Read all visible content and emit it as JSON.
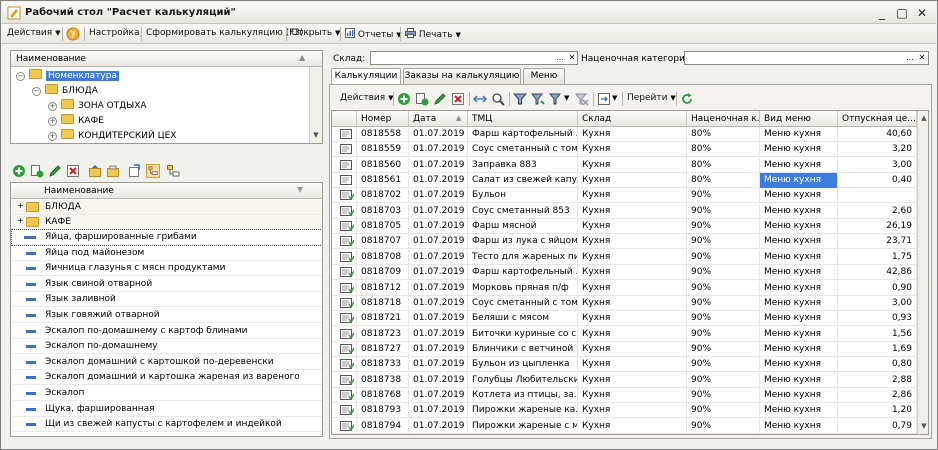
{
  "window": {
    "title": "Рабочий стол \"Расчет калькуляций\"",
    "minimize": "_",
    "maximize": "□",
    "close": "✕"
  },
  "toolbar": {
    "actions": "Действия",
    "settings": "Настройка",
    "form_calc": "Сформировать калькуляцию (F3)",
    "open": "Открыть",
    "reports": "Отчеты",
    "print": "Печать"
  },
  "tree": {
    "header": "Наименование",
    "items": [
      {
        "label": "Номенклатура",
        "level": 0
      },
      {
        "label": "БЛЮДА",
        "level": 1
      },
      {
        "label": "ЗОНА ОТДЫХА",
        "level": 2
      },
      {
        "label": "КАФЕ",
        "level": 2
      },
      {
        "label": "КОНДИТЕРСКИЙ ЦЕХ",
        "level": 2
      }
    ]
  },
  "list": {
    "header": "Наименование",
    "groups": [
      "БЛЮДА",
      "КАФЕ"
    ],
    "items": [
      "Яйца, фаршированные грибами",
      "Яйца под майонезом",
      "Яичница глазунья с мясн продуктами",
      "Язык свиной отварной",
      "Язык заливной",
      "Язык говяжий отварной",
      "Эскалоп по-домашнему с картоф блинами",
      "Эскалоп по-домашнему",
      "Эскалоп домашний с картошкой по-деревенски",
      "Эскалоп домашний и картошка жареная из вареного",
      "Эскалоп",
      "Щука, фаршированная",
      "Щи из свежей капусты с картофелем и индейкой"
    ]
  },
  "filters": {
    "warehouse_label": "Склад:",
    "warehouse_value": "",
    "category_label": "Наценочная категория:",
    "category_value": "",
    "dots": "...",
    "clear": "✕"
  },
  "tabs": [
    "Калькуляции",
    "Заказы на калькуляцию",
    "Меню"
  ],
  "grid_toolbar": {
    "actions": "Действия",
    "goto": "Перейти"
  },
  "grid": {
    "columns": [
      "Номер",
      "Дата",
      "ТМЦ",
      "Склад",
      "Наценочная к...",
      "Вид меню",
      "Отпускная це..."
    ],
    "rows": [
      [
        "0818558",
        "01.07.2019",
        "Фарш картофельный ...",
        "Кухня",
        "80%",
        "Меню кухня",
        "40,60"
      ],
      [
        "0818559",
        "01.07.2019",
        "Соус сметанный с том...",
        "Кухня",
        "80%",
        "Меню кухня",
        "3,20"
      ],
      [
        "0818560",
        "01.07.2019",
        "Заправка 883",
        "Кухня",
        "80%",
        "Меню кухня",
        "3,00"
      ],
      [
        "0818561",
        "01.07.2019",
        "Салат из свежей капу...",
        "Кухня",
        "80%",
        "Меню кухня",
        "0,40"
      ],
      [
        "0818702",
        "01.07.2019",
        "Бульон",
        "Кухня",
        "90%",
        "Меню кухня",
        ""
      ],
      [
        "0818703",
        "01.07.2019",
        "Соус сметанный 853",
        "Кухня",
        "90%",
        "Меню кухня",
        "2,60"
      ],
      [
        "0818705",
        "01.07.2019",
        "Фарш мясной",
        "Кухня",
        "90%",
        "Меню кухня",
        "26,19"
      ],
      [
        "0818707",
        "01.07.2019",
        "Фарш из лука с яйцом",
        "Кухня",
        "90%",
        "Меню кухня",
        "23,71"
      ],
      [
        "0818708",
        "01.07.2019",
        "Тесто для жареных пи...",
        "Кухня",
        "90%",
        "Меню кухня",
        "1,75"
      ],
      [
        "0818709",
        "01.07.2019",
        "Фарш картофельный ...",
        "Кухня",
        "90%",
        "Меню кухня",
        "42,86"
      ],
      [
        "0818712",
        "01.07.2019",
        "Морковь пряная п/ф",
        "Кухня",
        "90%",
        "Меню кухня",
        "0,90"
      ],
      [
        "0818718",
        "01.07.2019",
        "Соус сметанный с том...",
        "Кухня",
        "90%",
        "Меню кухня",
        "3,00"
      ],
      [
        "0818721",
        "01.07.2019",
        "Беляши с мясом",
        "Кухня",
        "90%",
        "Меню кухня",
        "0,93"
      ],
      [
        "0818723",
        "01.07.2019",
        "Биточки куриные со с...",
        "Кухня",
        "90%",
        "Меню кухня",
        "1,56"
      ],
      [
        "0818727",
        "01.07.2019",
        "Блинчики с ветчиной и...",
        "Кухня",
        "90%",
        "Меню кухня",
        "1,69"
      ],
      [
        "0818733",
        "01.07.2019",
        "Бульон из цыпленка",
        "Кухня",
        "90%",
        "Меню кухня",
        "0,80"
      ],
      [
        "0818738",
        "01.07.2019",
        "Голубцы Любительские",
        "Кухня",
        "90%",
        "Меню кухня",
        "2,88"
      ],
      [
        "0818768",
        "01.07.2019",
        "Котлета из птицы, за...",
        "Кухня",
        "90%",
        "Меню кухня",
        "2,86"
      ],
      [
        "0818793",
        "01.07.2019",
        "Пирожки жареные ка...",
        "Кухня",
        "90%",
        "Меню кухня",
        "1,20"
      ],
      [
        "0818794",
        "01.07.2019",
        "Пирожки жареные с м...",
        "Кухня",
        "90%",
        "Меню кухня",
        "0,79"
      ]
    ]
  },
  "colors": {
    "accent": "#3d7ddb",
    "green": "#2e9e3a",
    "folder": "#f0c850"
  }
}
